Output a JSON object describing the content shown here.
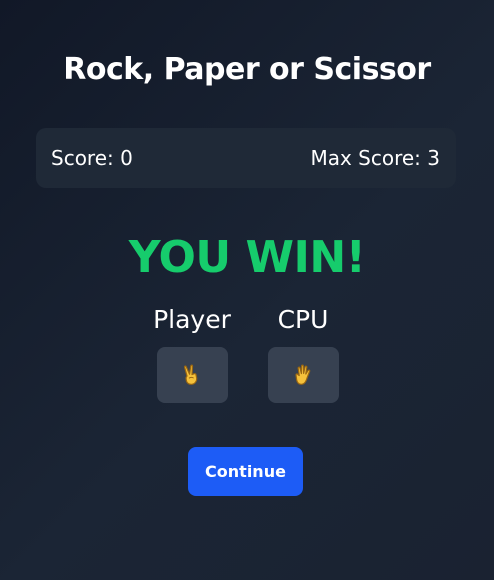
{
  "game": {
    "title": "Rock, Paper or Scissor"
  },
  "scoreboard": {
    "score_text": "Score: 0",
    "max_score_text": "Max Score: 3"
  },
  "result": {
    "text": "YOU WIN!",
    "color": "#16cc6c"
  },
  "player": {
    "label": "Player",
    "choice_icon": "scissors-hand-icon",
    "choice_emoji": "✌️"
  },
  "cpu": {
    "label": "CPU",
    "choice_icon": "paper-hand-icon",
    "choice_emoji": "✋"
  },
  "actions": {
    "continue_label": "Continue"
  },
  "colors": {
    "background": "#161f2e",
    "panel": "#1f2937",
    "choice_box": "#374151",
    "accent_button": "#1d5cf6",
    "win_text": "#16cc6c"
  }
}
